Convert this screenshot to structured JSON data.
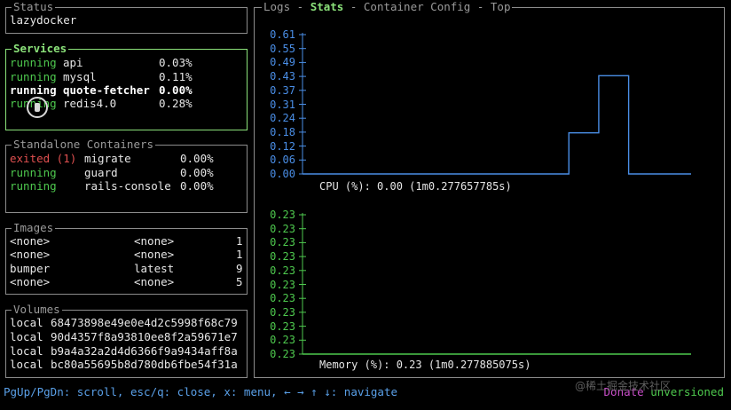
{
  "status": {
    "title": "Status",
    "name": "lazydocker"
  },
  "services": {
    "title": "Services",
    "items": [
      {
        "status": "running",
        "name": "api",
        "cpu": "0.03%"
      },
      {
        "status": "running",
        "name": "mysql",
        "cpu": "0.11%"
      },
      {
        "status": "running",
        "name": "quote-fetcher",
        "cpu": "0.00%"
      },
      {
        "status": "running",
        "name": "redis4.0",
        "cpu": "0.28%"
      }
    ]
  },
  "standalone": {
    "title": "Standalone Containers",
    "items": [
      {
        "status": "exited (1)",
        "name": "migrate",
        "cpu": "0.00%"
      },
      {
        "status": "running",
        "name": "guard",
        "cpu": "0.00%"
      },
      {
        "status": "running",
        "name": "rails-console",
        "cpu": "0.00%"
      }
    ]
  },
  "images": {
    "title": "Images",
    "items": [
      {
        "repo": "<none>",
        "tag": "<none>",
        "size": "1"
      },
      {
        "repo": "<none>",
        "tag": "<none>",
        "size": "1"
      },
      {
        "repo": "bumper",
        "tag": "latest",
        "size": "9"
      },
      {
        "repo": "<none>",
        "tag": "<none>",
        "size": "5"
      }
    ]
  },
  "volumes": {
    "title": "Volumes",
    "items": [
      {
        "driver": "local",
        "name": "68473898e49e0e4d2c5998f68c79"
      },
      {
        "driver": "local",
        "name": "90d4357f8a93810ee8f2a59671e7"
      },
      {
        "driver": "local",
        "name": "b9a4a32a2d4d6366f9a9434aff8a"
      },
      {
        "driver": "local",
        "name": "bc80a55695b8d780db6fbe54f31a"
      }
    ]
  },
  "main": {
    "tabs": [
      "Logs",
      "Stats",
      "Container Config",
      "Top"
    ],
    "active_tab": "Stats",
    "separator": " - "
  },
  "cpu_chart": {
    "ticks": [
      "0.61",
      "0.55",
      "0.49",
      "0.43",
      "0.37",
      "0.31",
      "0.24",
      "0.18",
      "0.12",
      "0.06",
      "0.00"
    ],
    "caption": "CPU (%): 0.00 (1m0.277657785s)",
    "color": "#4a8ee6"
  },
  "mem_chart": {
    "ticks": [
      "0.23",
      "0.23",
      "0.23",
      "0.23",
      "0.23",
      "0.23",
      "0.23",
      "0.23",
      "0.23",
      "0.23",
      "0.23"
    ],
    "caption": "Memory (%): 0.23 (1m0.277885075s)",
    "color": "#4ec94e"
  },
  "chart_data": [
    {
      "type": "line",
      "ylim": [
        0,
        0.61
      ],
      "x": [
        0,
        1,
        2,
        3,
        4,
        5,
        6,
        7,
        8,
        9,
        10,
        11,
        12,
        13
      ],
      "series": [
        {
          "values": [
            0,
            0,
            0,
            0,
            0,
            0,
            0,
            0,
            0,
            0.18,
            0.43,
            0,
            0,
            0
          ]
        }
      ]
    },
    {
      "type": "line",
      "ylim": [
        0.23,
        0.23
      ],
      "x": [
        0,
        1,
        2,
        3,
        4,
        5,
        6,
        7,
        8,
        9,
        10,
        11,
        12,
        13
      ],
      "series": [
        {
          "values": [
            0.23,
            0.23,
            0.23,
            0.23,
            0.23,
            0.23,
            0.23,
            0.23,
            0.23,
            0.23,
            0.23,
            0.23,
            0.23,
            0.23
          ]
        }
      ]
    }
  ],
  "footer": {
    "help": "PgUp/PgDn: scroll, esc/q: close, x: menu, ← → ↑ ↓: navigate",
    "donate": "Donate",
    "version": "unversioned"
  },
  "watermark": "@稀土掘金技术社区",
  "colors": {
    "running": "#4ec94e",
    "exited": "#e05050",
    "active_border": "#8be27a",
    "cpu_line": "#4a8ee6",
    "mem_line": "#4ec94e",
    "footer": "#5aa0e8",
    "donate": "#c94ec9"
  }
}
